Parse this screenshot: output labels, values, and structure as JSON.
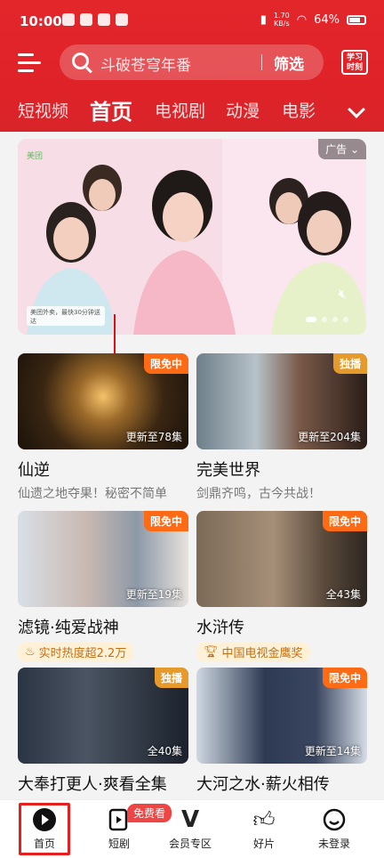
{
  "status": {
    "time": "10:00",
    "net_speed": "1.70",
    "net_unit": "KB/s",
    "battery": "64%"
  },
  "search": {
    "placeholder": "斗破苍穹年番",
    "filter": "筛选"
  },
  "study_label": "学习时刻",
  "tabs": [
    "短视频",
    "首页",
    "电视剧",
    "动漫",
    "电影"
  ],
  "banner": {
    "ad_label": "广告",
    "ad_brand": "美团",
    "ad_caption": "美团外卖，最快30分钟送达"
  },
  "cards": [
    {
      "title": "仙逆",
      "sub": "仙遗之地夺果！秘密不简单",
      "badge": "限免中",
      "update": "更新至78集"
    },
    {
      "title": "完美世界",
      "sub": "剑鼎齐鸣，古今共战！",
      "badge": "独播",
      "update": "更新至204集"
    },
    {
      "title": "滤镜·纯爱战神",
      "pill": "实时热度超2.2万",
      "badge": "限免中",
      "update": "更新至19集"
    },
    {
      "title": "水浒传",
      "pill": "中国电视金鹰奖",
      "badge": "限免中",
      "update": "全43集"
    },
    {
      "title": "大奉打更人·爽看全集",
      "badge": "独播",
      "update": "全40集"
    },
    {
      "title": "大河之水·薪火相传",
      "badge": "限免中",
      "update": "更新至14集"
    }
  ],
  "bottom_nav": {
    "home": "首页",
    "short": "短剧",
    "free_badge": "免费看",
    "vip": "会员专区",
    "good": "好片",
    "login": "未登录"
  }
}
